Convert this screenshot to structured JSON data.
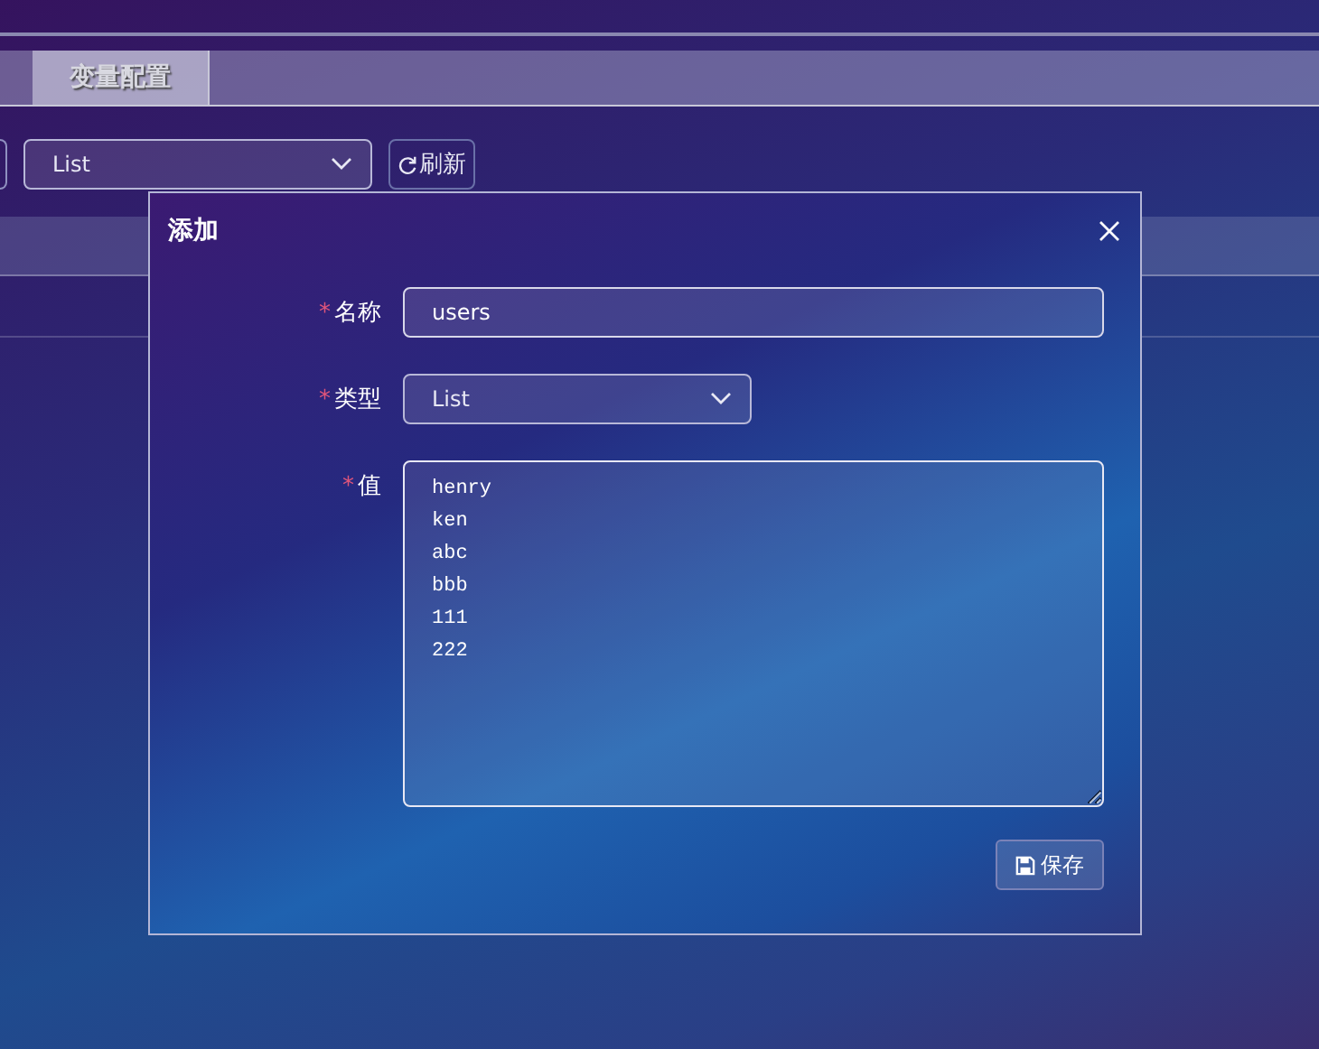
{
  "tabs": [
    {
      "label": "变量配置",
      "selected": true
    }
  ],
  "toolbar": {
    "type_select": {
      "value": "List"
    },
    "refresh_button": {
      "label": "刷新"
    }
  },
  "dialog": {
    "title": "添加",
    "fields": [
      {
        "kind": "text",
        "label": "名称",
        "required_mark": "*",
        "value": "users"
      },
      {
        "kind": "select",
        "label": "类型",
        "required_mark": "*",
        "value": "List"
      },
      {
        "kind": "textarea",
        "label": "值",
        "required_mark": "*",
        "value": "henry\nken\nabc\nbbb\n111\n222"
      }
    ],
    "save_button": {
      "label": "保存"
    }
  }
}
